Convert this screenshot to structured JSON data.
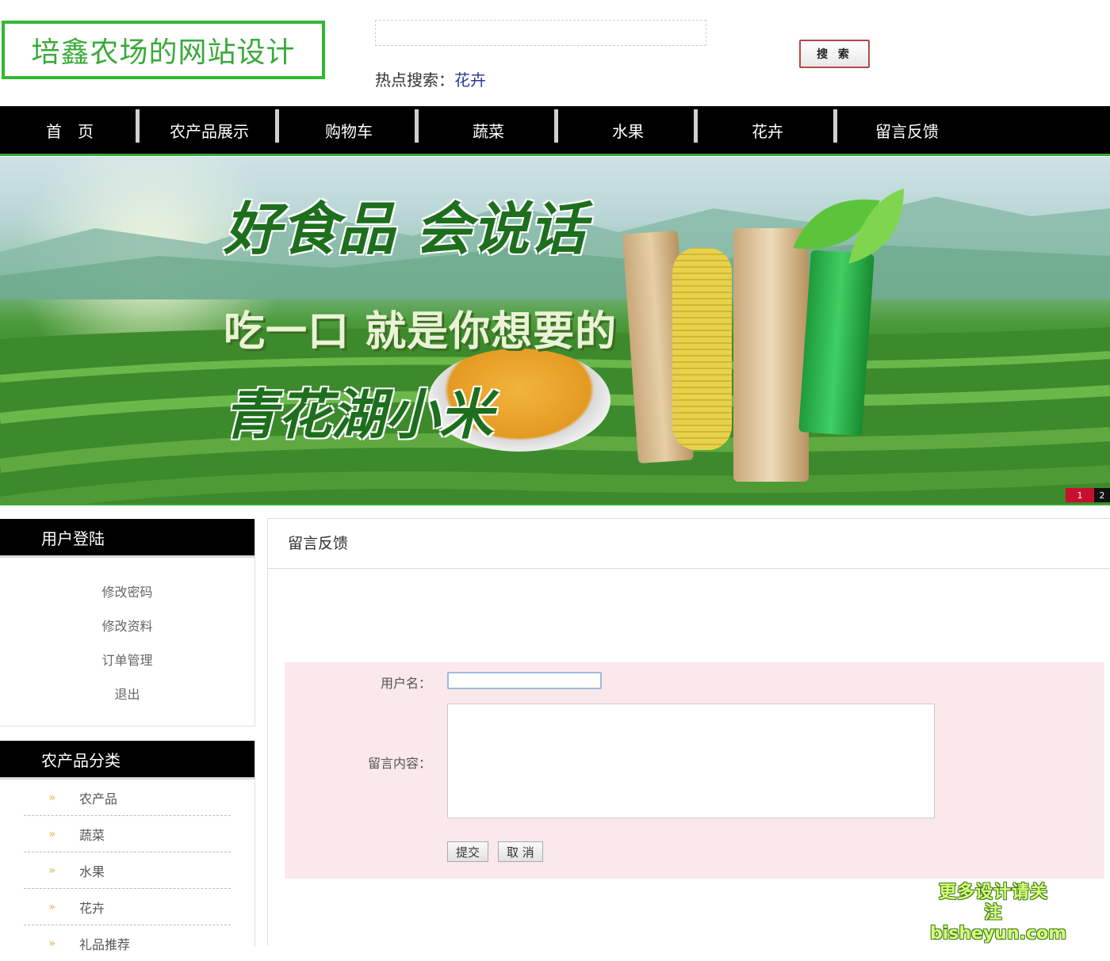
{
  "header": {
    "site_title": "培鑫农场的网站设计",
    "search_placeholder": "",
    "hot_label": "热点搜索：",
    "hot_link": "花卉",
    "search_button": "搜 索"
  },
  "nav": [
    "首　页",
    "农产品展示",
    "购物车",
    "蔬菜",
    "水果",
    "花卉",
    "留言反馈"
  ],
  "banner": {
    "line1": "好食品 会说话",
    "line2": "吃一口 就是你想要的",
    "line3": "青花湖小米",
    "pager": [
      "1",
      "2"
    ]
  },
  "user_panel": {
    "title": "用户登陆",
    "links": [
      "修改密码",
      "修改资料",
      "订单管理",
      "退出"
    ]
  },
  "category_panel": {
    "title": "农产品分类",
    "items": [
      "农产品",
      "蔬菜",
      "水果",
      "花卉",
      "礼品推荐"
    ]
  },
  "main": {
    "title": "留言反馈",
    "username_label": "用户名：",
    "username_value": "",
    "message_label": "留言内容：",
    "message_value": "",
    "submit_button": "提交",
    "cancel_button": "取 消"
  },
  "watermark": {
    "line1": "更多设计请关注",
    "line2": "bisheyun.com"
  },
  "colors": {
    "brand_green": "#3aa93a",
    "nav_bg": "#000000",
    "form_bg": "#fbe8ea"
  }
}
